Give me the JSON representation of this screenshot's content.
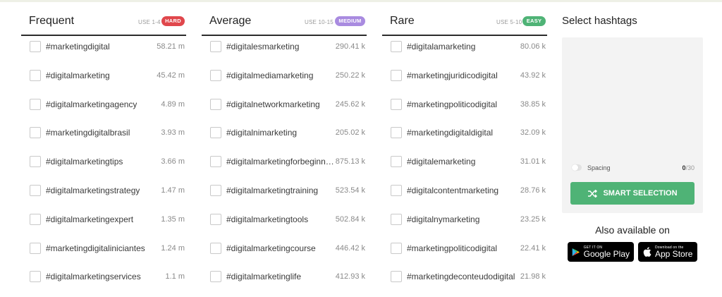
{
  "columns": [
    {
      "title": "Frequent",
      "use_label": "USE 1-4",
      "badge": "HARD",
      "badge_color": "#e0474c",
      "rows": [
        {
          "tag": "#marketingdigital",
          "count": "58.21 m"
        },
        {
          "tag": "#digitalmarketing",
          "count": "45.42 m"
        },
        {
          "tag": "#digitalmarketingagency",
          "count": "4.89 m"
        },
        {
          "tag": "#marketingdigitalbrasil",
          "count": "3.93 m"
        },
        {
          "tag": "#digitalmarketingtips",
          "count": "3.66 m"
        },
        {
          "tag": "#digitalmarketingstrategy",
          "count": "1.47 m"
        },
        {
          "tag": "#digitalmarketingexpert",
          "count": "1.35 m"
        },
        {
          "tag": "#marketingdigitaliniciantes",
          "count": "1.24 m"
        },
        {
          "tag": "#digitalmarketingservices",
          "count": "1.1 m"
        }
      ]
    },
    {
      "title": "Average",
      "use_label": "USE 10-15",
      "badge": "MEDIUM",
      "badge_color": "#a98be0",
      "rows": [
        {
          "tag": "#digitalesmarketing",
          "count": "290.41 k"
        },
        {
          "tag": "#digitalmediamarketing",
          "count": "250.22 k"
        },
        {
          "tag": "#digitalnetworkmarketing",
          "count": "245.62 k"
        },
        {
          "tag": "#digitalnimarketing",
          "count": "205.02 k"
        },
        {
          "tag": "#digitalmarketingforbeginners",
          "count": "875.13 k"
        },
        {
          "tag": "#digitalmarketingtraining",
          "count": "523.54 k"
        },
        {
          "tag": "#digitalmarketingtools",
          "count": "502.84 k"
        },
        {
          "tag": "#digitalmarketingcourse",
          "count": "446.42 k"
        },
        {
          "tag": "#digitalmarketinglife",
          "count": "412.93 k"
        }
      ]
    },
    {
      "title": "Rare",
      "use_label": "USE 5-10",
      "badge": "EASY",
      "badge_color": "#4fb376",
      "rows": [
        {
          "tag": "#digitalamarketing",
          "count": "80.06 k"
        },
        {
          "tag": "#marketingjuridicodigital",
          "count": "43.92 k"
        },
        {
          "tag": "#marketingpoliticodigital",
          "count": "38.85 k"
        },
        {
          "tag": "#marketingdigitaldigital",
          "count": "32.09 k"
        },
        {
          "tag": "#digitalemarketing",
          "count": "31.01 k"
        },
        {
          "tag": "#digitalcontentmarketing",
          "count": "28.76 k"
        },
        {
          "tag": "#digitalnymarketing",
          "count": "23.25 k"
        },
        {
          "tag": "#marketingpoliticodigital",
          "count": "22.41 k"
        },
        {
          "tag": "#marketingdeconteudodigital",
          "count": "21.98 k"
        }
      ]
    }
  ],
  "select_panel": {
    "title": "Select hashtags",
    "spacing_label": "Spacing",
    "selected_count": "0",
    "max_count": "/30",
    "smart_button": "SMART SELECTION",
    "accent_color": "#4fb376"
  },
  "apps": {
    "heading": "Also available on",
    "google_small": "GET IT ON",
    "google_big": "Google Play",
    "apple_small": "Download on the",
    "apple_big": "App Store"
  }
}
